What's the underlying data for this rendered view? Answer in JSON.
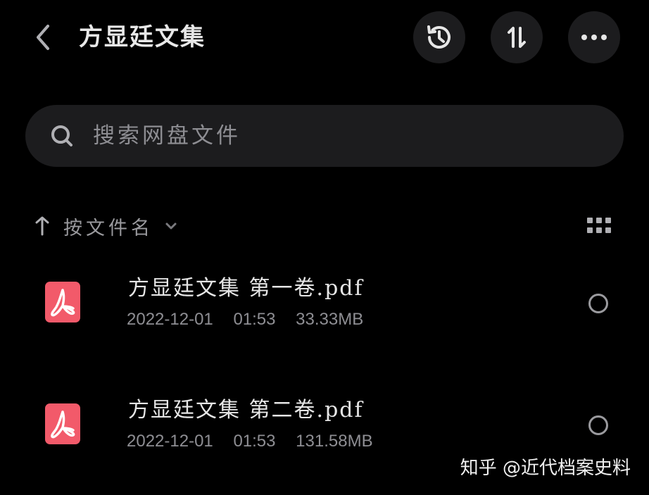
{
  "header": {
    "title": "方显廷文集",
    "back_icon": "chevron-left-icon",
    "actions": [
      {
        "name": "history",
        "icon": "history-icon"
      },
      {
        "name": "sort",
        "icon": "sort-arrows-icon"
      },
      {
        "name": "more",
        "icon": "more-dots-icon"
      }
    ]
  },
  "search": {
    "placeholder": "搜索网盘文件",
    "value": ""
  },
  "sort_bar": {
    "label": "按文件名",
    "view_icon": "grid-view-icon"
  },
  "files": [
    {
      "name": "方显廷文集 第一卷.pdf",
      "date": "2022-12-01",
      "time": "01:53",
      "size": "33.33MB",
      "icon": "pdf-icon",
      "selected": false
    },
    {
      "name": "方显廷文集 第二卷.pdf",
      "date": "2022-12-01",
      "time": "01:53",
      "size": "131.58MB",
      "icon": "pdf-icon",
      "selected": false
    }
  ],
  "watermark": "知乎 @近代档案史料",
  "colors": {
    "background": "#000000",
    "surface": "#1c1c1e",
    "text_primary": "#e6e6e6",
    "text_secondary": "#8e8e93",
    "pdf_red": "#f25a6a"
  }
}
